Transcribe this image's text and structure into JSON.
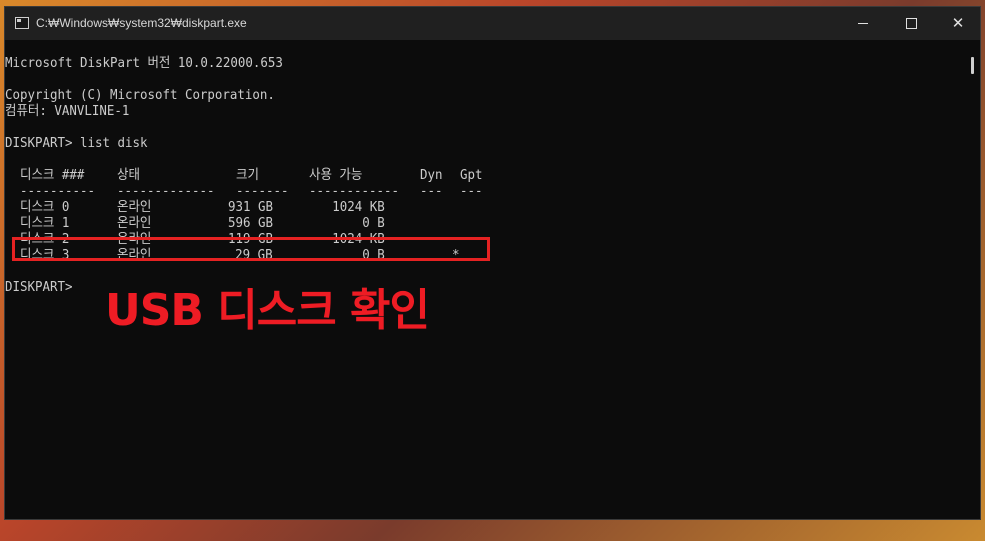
{
  "window": {
    "title": "C:₩Windows₩system32₩diskpart.exe",
    "minimize": "minimize",
    "maximize": "maximize",
    "close": "✕"
  },
  "console": {
    "header_line1": "Microsoft DiskPart 버전 10.0.22000.653",
    "copyright": "Copyright (C) Microsoft Corporation.",
    "computer": "컴퓨터: VANVLINE-1",
    "command": "DISKPART> list disk",
    "prompt": "DISKPART>"
  },
  "disk_table": {
    "columns": [
      "디스크 ###",
      "상태",
      "크기",
      "사용 가능",
      "Dyn",
      "Gpt"
    ],
    "separators": [
      "----------",
      "-------------",
      "-------",
      "------------",
      "---",
      "---"
    ],
    "rows": [
      {
        "disk": "디스크 0",
        "status": "온라인",
        "size": "931 GB",
        "free": "1024 KB",
        "dyn": "",
        "gpt": ""
      },
      {
        "disk": "디스크 1",
        "status": "온라인",
        "size": "596 GB",
        "free": "0 B",
        "dyn": "",
        "gpt": ""
      },
      {
        "disk": "디스크 2",
        "status": "온라인",
        "size": "119 GB",
        "free": "1024 KB",
        "dyn": "",
        "gpt": ""
      },
      {
        "disk": "디스크 3",
        "status": "온라인",
        "size": "29 GB",
        "free": "0 B",
        "dyn": "",
        "gpt": "*"
      }
    ]
  },
  "annotation": {
    "text": "USB 디스크 확인",
    "color": "#ee1c24"
  }
}
